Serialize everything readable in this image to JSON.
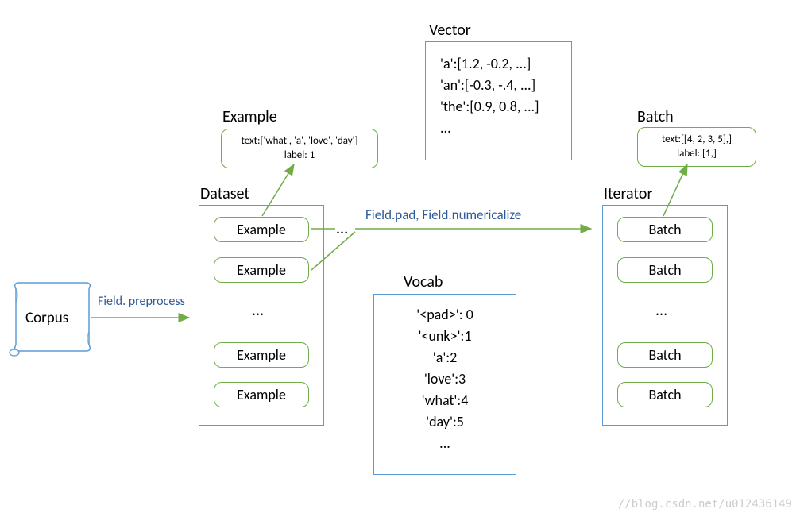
{
  "corpus": {
    "label": "Corpus"
  },
  "arrows": {
    "preprocess": "Field. preprocess",
    "pad_numericalize": "Field.pad, Field.numericalize"
  },
  "dataset": {
    "title": "Dataset",
    "items": [
      "Example",
      "Example",
      "...",
      "Example",
      "Example"
    ]
  },
  "example": {
    "title": "Example",
    "text_line": "text:['what', 'a', 'love', 'day']",
    "label_line": "label: 1"
  },
  "vector": {
    "title": "Vector",
    "lines": [
      "'a':[1.2, -0.2, ...]",
      "'an':[-0.3, -.4, ...]",
      "'the':[0.9, 0.8, ...]",
      "..."
    ]
  },
  "vocab": {
    "title": "Vocab",
    "lines": [
      "'<pad>': 0",
      "'<unk>':1",
      "'a':2",
      "'love':3",
      "'what':4",
      "'day':5",
      "..."
    ]
  },
  "iterator": {
    "title": "Iterator",
    "items": [
      "Batch",
      "Batch",
      "...",
      "Batch",
      "Batch"
    ]
  },
  "batch": {
    "title": "Batch",
    "text_line": "text:[[4, 2, 3, 5],]",
    "label_line": "label: [1,]"
  },
  "watermark": "//blog.csdn.net/u012436149"
}
